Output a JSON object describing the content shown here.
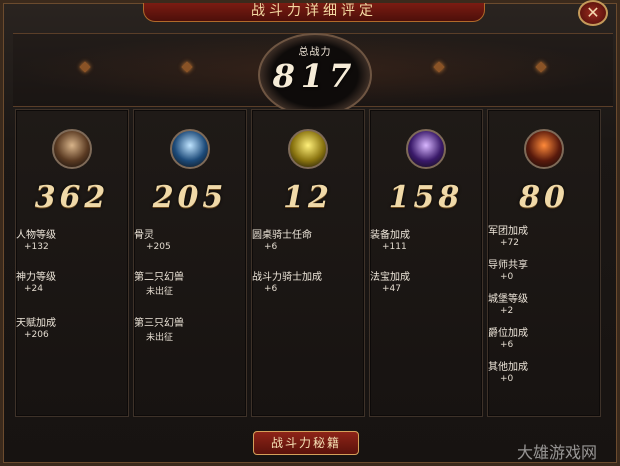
{
  "window": {
    "title": "战斗力详细评定"
  },
  "total": {
    "label": "总战力",
    "value": "817"
  },
  "panels": [
    {
      "avatar_icon": "warrior-portrait-icon",
      "avatar_colors": [
        "#d8b48a",
        "#5a3a22"
      ],
      "score": "362",
      "items": [
        {
          "label": "人物等级",
          "value": "+132"
        },
        {
          "label": "神力等级",
          "value": "+24"
        },
        {
          "label": "天赋加成",
          "value": "+206"
        }
      ]
    },
    {
      "avatar_icon": "ice-beast-icon",
      "avatar_colors": [
        "#bfe4ff",
        "#1d4b7a"
      ],
      "score": "205",
      "items": [
        {
          "label": "骨灵",
          "value": "+205"
        },
        {
          "label": "第二只幻兽",
          "value": "未出征"
        },
        {
          "label": "第三只幻兽",
          "value": "未出征"
        }
      ]
    },
    {
      "avatar_icon": "yellow-chick-icon",
      "avatar_colors": [
        "#fff07a",
        "#8a7410"
      ],
      "score": "12",
      "items": [
        {
          "label": "圆桌骑士任命",
          "value": "+6"
        },
        {
          "label": "战斗力骑士加成",
          "value": "+6"
        }
      ]
    },
    {
      "avatar_icon": "purple-armor-icon",
      "avatar_colors": [
        "#d8b6ff",
        "#3a1a6a"
      ],
      "score": "158",
      "items": [
        {
          "label": "装备加成",
          "value": "+111"
        },
        {
          "label": "法宝加成",
          "value": "+47"
        }
      ]
    },
    {
      "avatar_icon": "red-shield-icon",
      "avatar_colors": [
        "#ff8a3a",
        "#5a1a0c"
      ],
      "score": "80",
      "items": [
        {
          "label": "军团加成",
          "value": "+72"
        },
        {
          "label": "导师共享",
          "value": "+0"
        },
        {
          "label": "城堡等级",
          "value": "+2"
        },
        {
          "label": "爵位加成",
          "value": "+6"
        },
        {
          "label": "其他加成",
          "value": "+0"
        }
      ]
    }
  ],
  "bottom_button": {
    "label": "战斗力秘籍"
  },
  "watermark": {
    "text": "大雄游戏网"
  },
  "colors": {
    "accent": "#8e2418",
    "gold": "#f0d9a8",
    "border": "#3e3229"
  }
}
